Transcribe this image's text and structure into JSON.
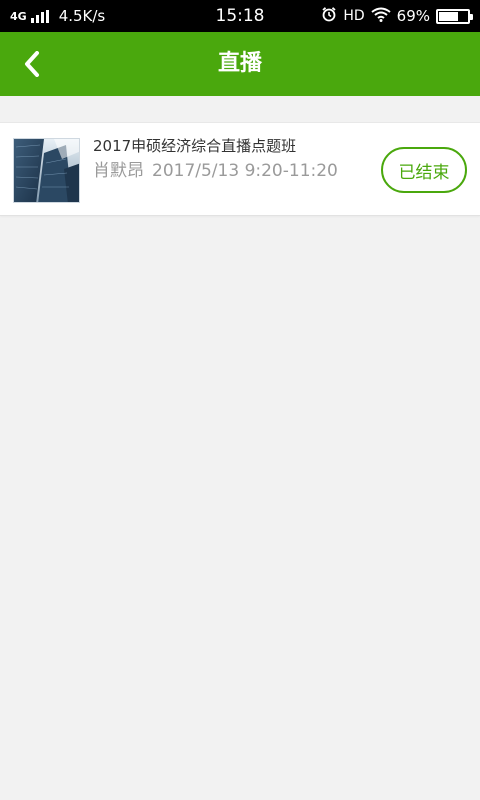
{
  "status_bar": {
    "network": "4G",
    "speed": "4.5K/s",
    "time": "15:18",
    "hd": "HD",
    "battery_percent": "69%",
    "battery_level": 0.69,
    "icons": [
      "signal-icon",
      "alarm-icon",
      "wifi-icon",
      "battery-icon"
    ]
  },
  "nav": {
    "title": "直播",
    "back_icon": "chevron-left-icon"
  },
  "colors": {
    "brand_green": "#4aa80d",
    "background": "#f2f2f2",
    "meta_gray": "#9a9a9a"
  },
  "live_list": [
    {
      "title": "2017申硕经济综合直播点题班",
      "teacher": "肖默昂",
      "datetime": "2017/5/13 9:20-11:20",
      "status": "已结束",
      "thumbnail": "building-photo"
    }
  ]
}
